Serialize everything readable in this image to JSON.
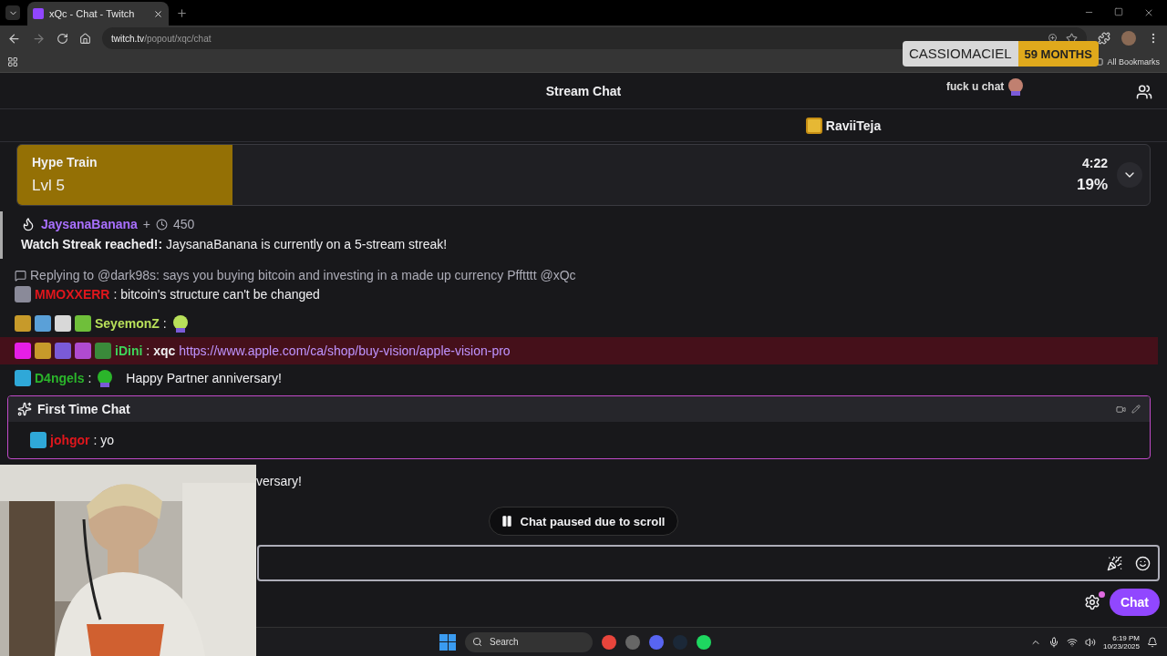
{
  "browser": {
    "tab_title": "xQc - Chat - Twitch",
    "url_host": "twitch.tv",
    "url_path": "/popout/xqc/chat",
    "bookmarks_label": "All Bookmarks"
  },
  "overlays": {
    "sub_name": "CASSIOMACIEL",
    "sub_months": "59 MONTHS",
    "floating_message": "fuck u chat",
    "gift_name": "RaviiTeja"
  },
  "chat": {
    "title": "Stream Chat"
  },
  "hype_train": {
    "title": "Hype Train",
    "level_label": "Lvl 5",
    "time": "4:22",
    "percent": "19%",
    "level": 0.19
  },
  "messages": [
    {
      "kind": "streak",
      "user": "JaysanaBanana",
      "color": "#a970ff",
      "points": "+",
      "points_value": "450",
      "text": "**Watch Streak reached!:** JaysanaBanana is currently on a 5-stream streak!"
    },
    {
      "kind": "reply",
      "reply": "Replying to @dark98s: says you buying bitcoin and investing in a made up currency Pfftttt @xQc",
      "badges": [
        {
          "color": "#8a8a99"
        }
      ],
      "user": "MMOXXERR",
      "color": "#e0161c",
      "text": ": bitcoin's structure can't be changed",
      "highlighted": false
    },
    {
      "kind": "chat",
      "badges": [
        {
          "color": "#c79a2a"
        },
        {
          "color": "#5aa0d8"
        },
        {
          "color": "#d8d8d8"
        },
        {
          "color": "#6fbf3a"
        }
      ],
      "user": "SeyemonZ",
      "color": "#b8e05a",
      "text": ":",
      "emote": true,
      "highlighted": false
    },
    {
      "kind": "chat",
      "badges": [
        {
          "color": "#e61ee6"
        },
        {
          "color": "#c79a2a"
        },
        {
          "color": "#7a5ad8"
        },
        {
          "color": "#b04ad0"
        },
        {
          "color": "#3a8a3a"
        }
      ],
      "user": "iDini",
      "color": "#3ed45a",
      "text": ": **xqc**",
      "link": "https://www.apple.com/ca/shop/buy-vision/apple-vision-pro",
      "emote": false,
      "highlighted": true
    },
    {
      "kind": "chat",
      "badges": [
        {
          "color": "#2fa8d8"
        }
      ],
      "user": "D4ngels",
      "color": "#2bb52b",
      "text": ":",
      "emote": true,
      "after": "Happy Partner anniversary!",
      "highlighted": false
    }
  ],
  "first_time": {
    "title": "First Time Chat",
    "badges": [
      {
        "color": "#2fa8d8"
      }
    ],
    "user": "johgor",
    "color": "#e0161c",
    "text": ": yo"
  },
  "partial_line": "versary!",
  "paused": "Chat paused due to scroll",
  "send_button": "Chat",
  "taskbar": {
    "search": "Search",
    "time": "6:19 PM",
    "date": "10/23/2025"
  }
}
